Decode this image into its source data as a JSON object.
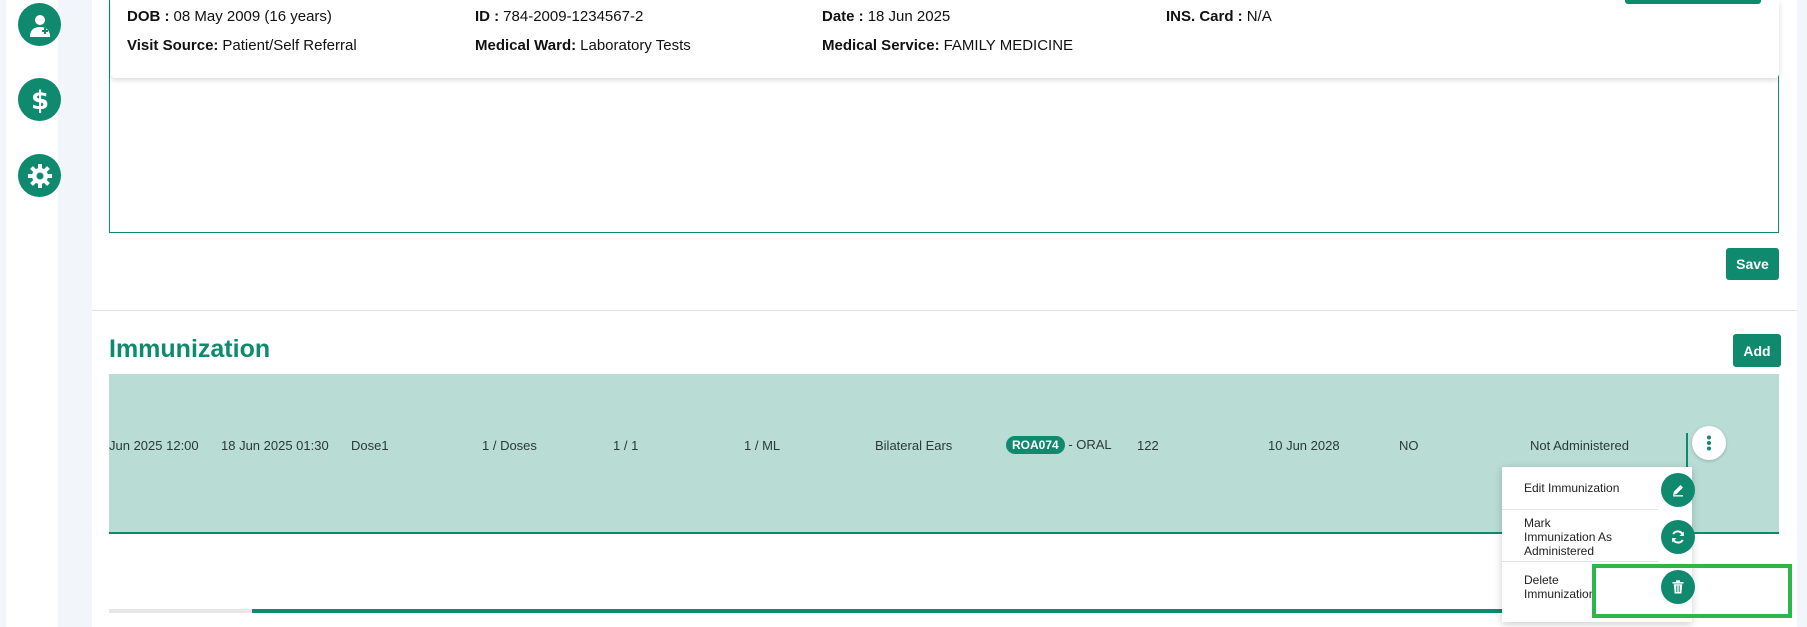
{
  "patient": {
    "dob_label": "DOB :",
    "dob_value": "08 May 2009 (16 years)",
    "id_label": "ID :",
    "id_value": "784-2009-1234567-2",
    "date_label": "Date :",
    "date_value": "18 Jun 2025",
    "ins_label": "INS. Card :",
    "ins_value": "N/A",
    "visit_label": "Visit Source:",
    "visit_value": "Patient/Self Referral",
    "ward_label": "Medical Ward:",
    "ward_value": "Laboratory Tests",
    "service_label": "Medical Service:",
    "service_value": "FAMILY MEDICINE"
  },
  "notes": {
    "save_label": "Save"
  },
  "immunization": {
    "title": "Immunization",
    "add_label": "Add",
    "row": {
      "date1": "Jun 2025 12:00",
      "date2": "18 Jun 2025 01:30",
      "dose": "Dose1",
      "doses": "1 / Doses",
      "count": "1 / 1",
      "amount": "1 / ML",
      "site": "Bilateral Ears",
      "route_code": "ROA074",
      "route_name": "- ORAL",
      "lot": "122",
      "expiry": "10 Jun 2028",
      "flag": "NO",
      "status": "Not Administered"
    },
    "menu": {
      "edit": "Edit Immunization",
      "mark": "Mark Immunization As Administered",
      "delete": "Delete Immunization"
    }
  },
  "colors": {
    "primary": "#0f8a6e",
    "row_bg": "#b9dcd5",
    "highlight": "#2db64a"
  },
  "icons": [
    "doctor-icon",
    "dollar-icon",
    "gear-icon",
    "kebab-icon",
    "pencil-icon",
    "refresh-icon",
    "trash-icon"
  ]
}
